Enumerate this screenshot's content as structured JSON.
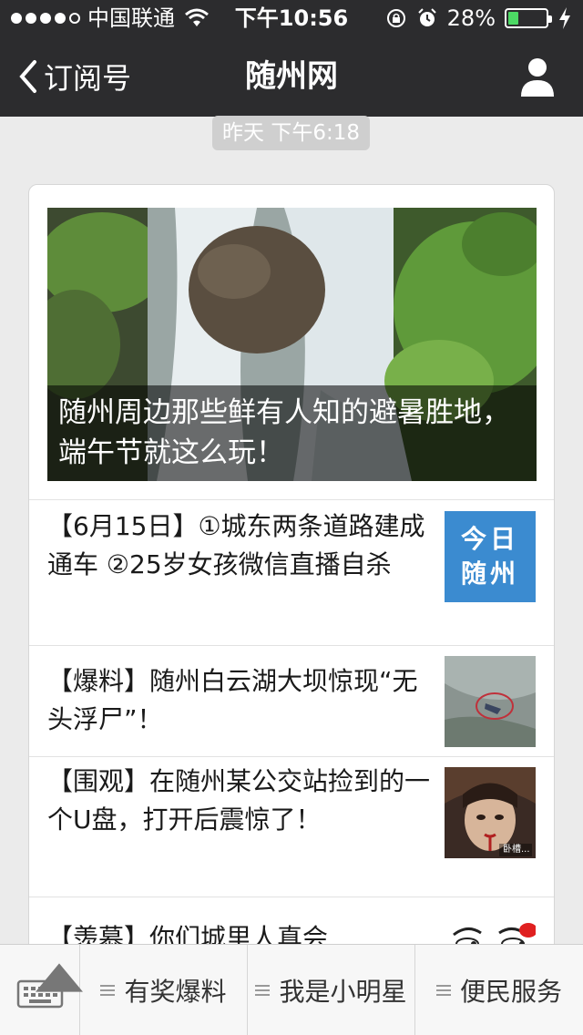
{
  "status": {
    "carrier": "中国联通",
    "time": "下午10:56",
    "battery": "28%",
    "battery_level": 0.28
  },
  "nav": {
    "back_label": "订阅号",
    "title": "随州网"
  },
  "timestamp": "昨天 下午6:18",
  "cover": {
    "caption": "随州周边那些鲜有人知的避暑胜地，端午节就这么玩！"
  },
  "articles": [
    {
      "title": "【6月15日】①城东两条道路建成通车 ②25岁女孩微信直播自杀",
      "thumb_text": [
        "今日",
        "随州"
      ]
    },
    {
      "title": "【爆料】随州白云湖大坝惊现“无头浮尸”！"
    },
    {
      "title": "【围观】在随州某公交站捡到的一个U盘，打开后震惊了！",
      "thumb_caption": "卧槽..."
    },
    {
      "title": "【羡慕】你们城里人真会"
    }
  ],
  "menu": {
    "items": [
      "有奖爆料",
      "我是小明星",
      "便民服务"
    ]
  },
  "colors": {
    "topbar": "#2c2c2e",
    "battery": "#4cd964",
    "logo_blue": "#3b8bd0"
  }
}
